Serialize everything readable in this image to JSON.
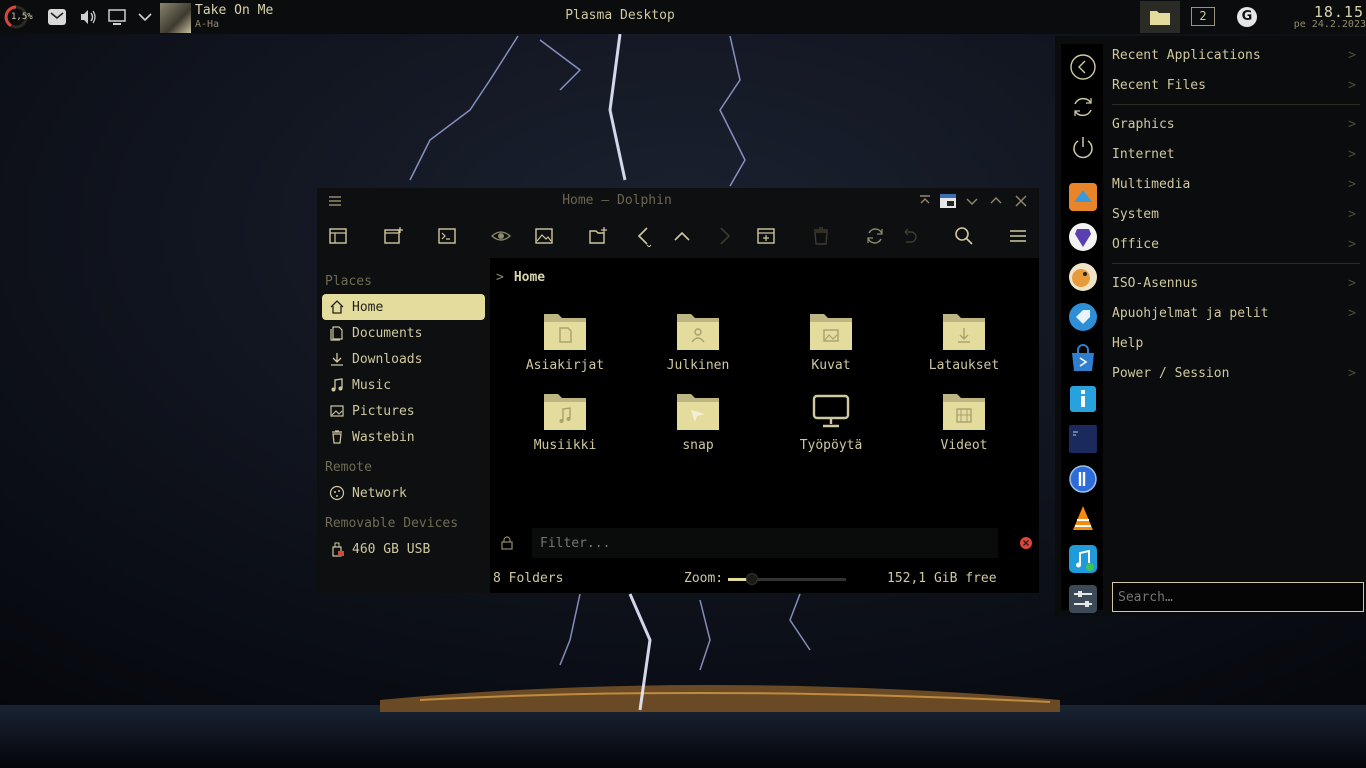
{
  "panel": {
    "cpu_label": "1,5%",
    "now_playing": {
      "title": "Take On Me",
      "artist": "A-Ha"
    },
    "window_title": "Plasma Desktop",
    "desktop_number": "2",
    "g_label": "G",
    "clock": {
      "time": "18.15",
      "date": "pe 24.2.2023"
    }
  },
  "dolphin": {
    "title": "Home — Dolphin",
    "sidebar": {
      "places_header": "Places",
      "places": [
        {
          "label": "Home",
          "icon": "home-icon",
          "active": true
        },
        {
          "label": "Documents",
          "icon": "documents-icon"
        },
        {
          "label": "Downloads",
          "icon": "downloads-icon"
        },
        {
          "label": "Music",
          "icon": "music-icon"
        },
        {
          "label": "Pictures",
          "icon": "pictures-icon"
        },
        {
          "label": "Wastebin",
          "icon": "wastebin-icon"
        }
      ],
      "remote_header": "Remote",
      "remote": [
        {
          "label": "Network",
          "icon": "network-icon"
        }
      ],
      "removable_header": "Removable Devices",
      "removable": [
        {
          "label": "460 GB USB",
          "icon": "usb-icon"
        }
      ]
    },
    "breadcrumb": "Home",
    "folders": [
      {
        "name": "Asiakirjat",
        "icon": "document-folder-icon"
      },
      {
        "name": "Julkinen",
        "icon": "public-folder-icon"
      },
      {
        "name": "Kuvat",
        "icon": "pictures-folder-icon"
      },
      {
        "name": "Lataukset",
        "icon": "downloads-folder-icon"
      },
      {
        "name": "Musiikki",
        "icon": "music-folder-icon"
      },
      {
        "name": "snap",
        "icon": "snap-folder-icon"
      },
      {
        "name": "Työpöytä",
        "icon": "desktop-monitor-icon"
      },
      {
        "name": "Videot",
        "icon": "videos-folder-icon"
      }
    ],
    "filter_placeholder": "Filter...",
    "status": {
      "count": "8 Folders",
      "zoom_label": "Zoom:",
      "zoom_level": 0.2,
      "free": "152,1 GiB free"
    }
  },
  "menu": {
    "categories_top": [
      {
        "label": "Recent Applications"
      },
      {
        "label": "Recent Files"
      }
    ],
    "categories_mid": [
      {
        "label": "Graphics"
      },
      {
        "label": "Internet"
      },
      {
        "label": "Multimedia"
      },
      {
        "label": "System"
      },
      {
        "label": "Office"
      }
    ],
    "categories_bottom": [
      {
        "label": "ISO-Asennus"
      },
      {
        "label": "Apuohjelmat ja pelit"
      },
      {
        "label": "Help"
      },
      {
        "label": "Power / Session"
      }
    ],
    "arrow_glyph": ">",
    "search_placeholder": "Search…",
    "accent": "#e3dc9c"
  }
}
